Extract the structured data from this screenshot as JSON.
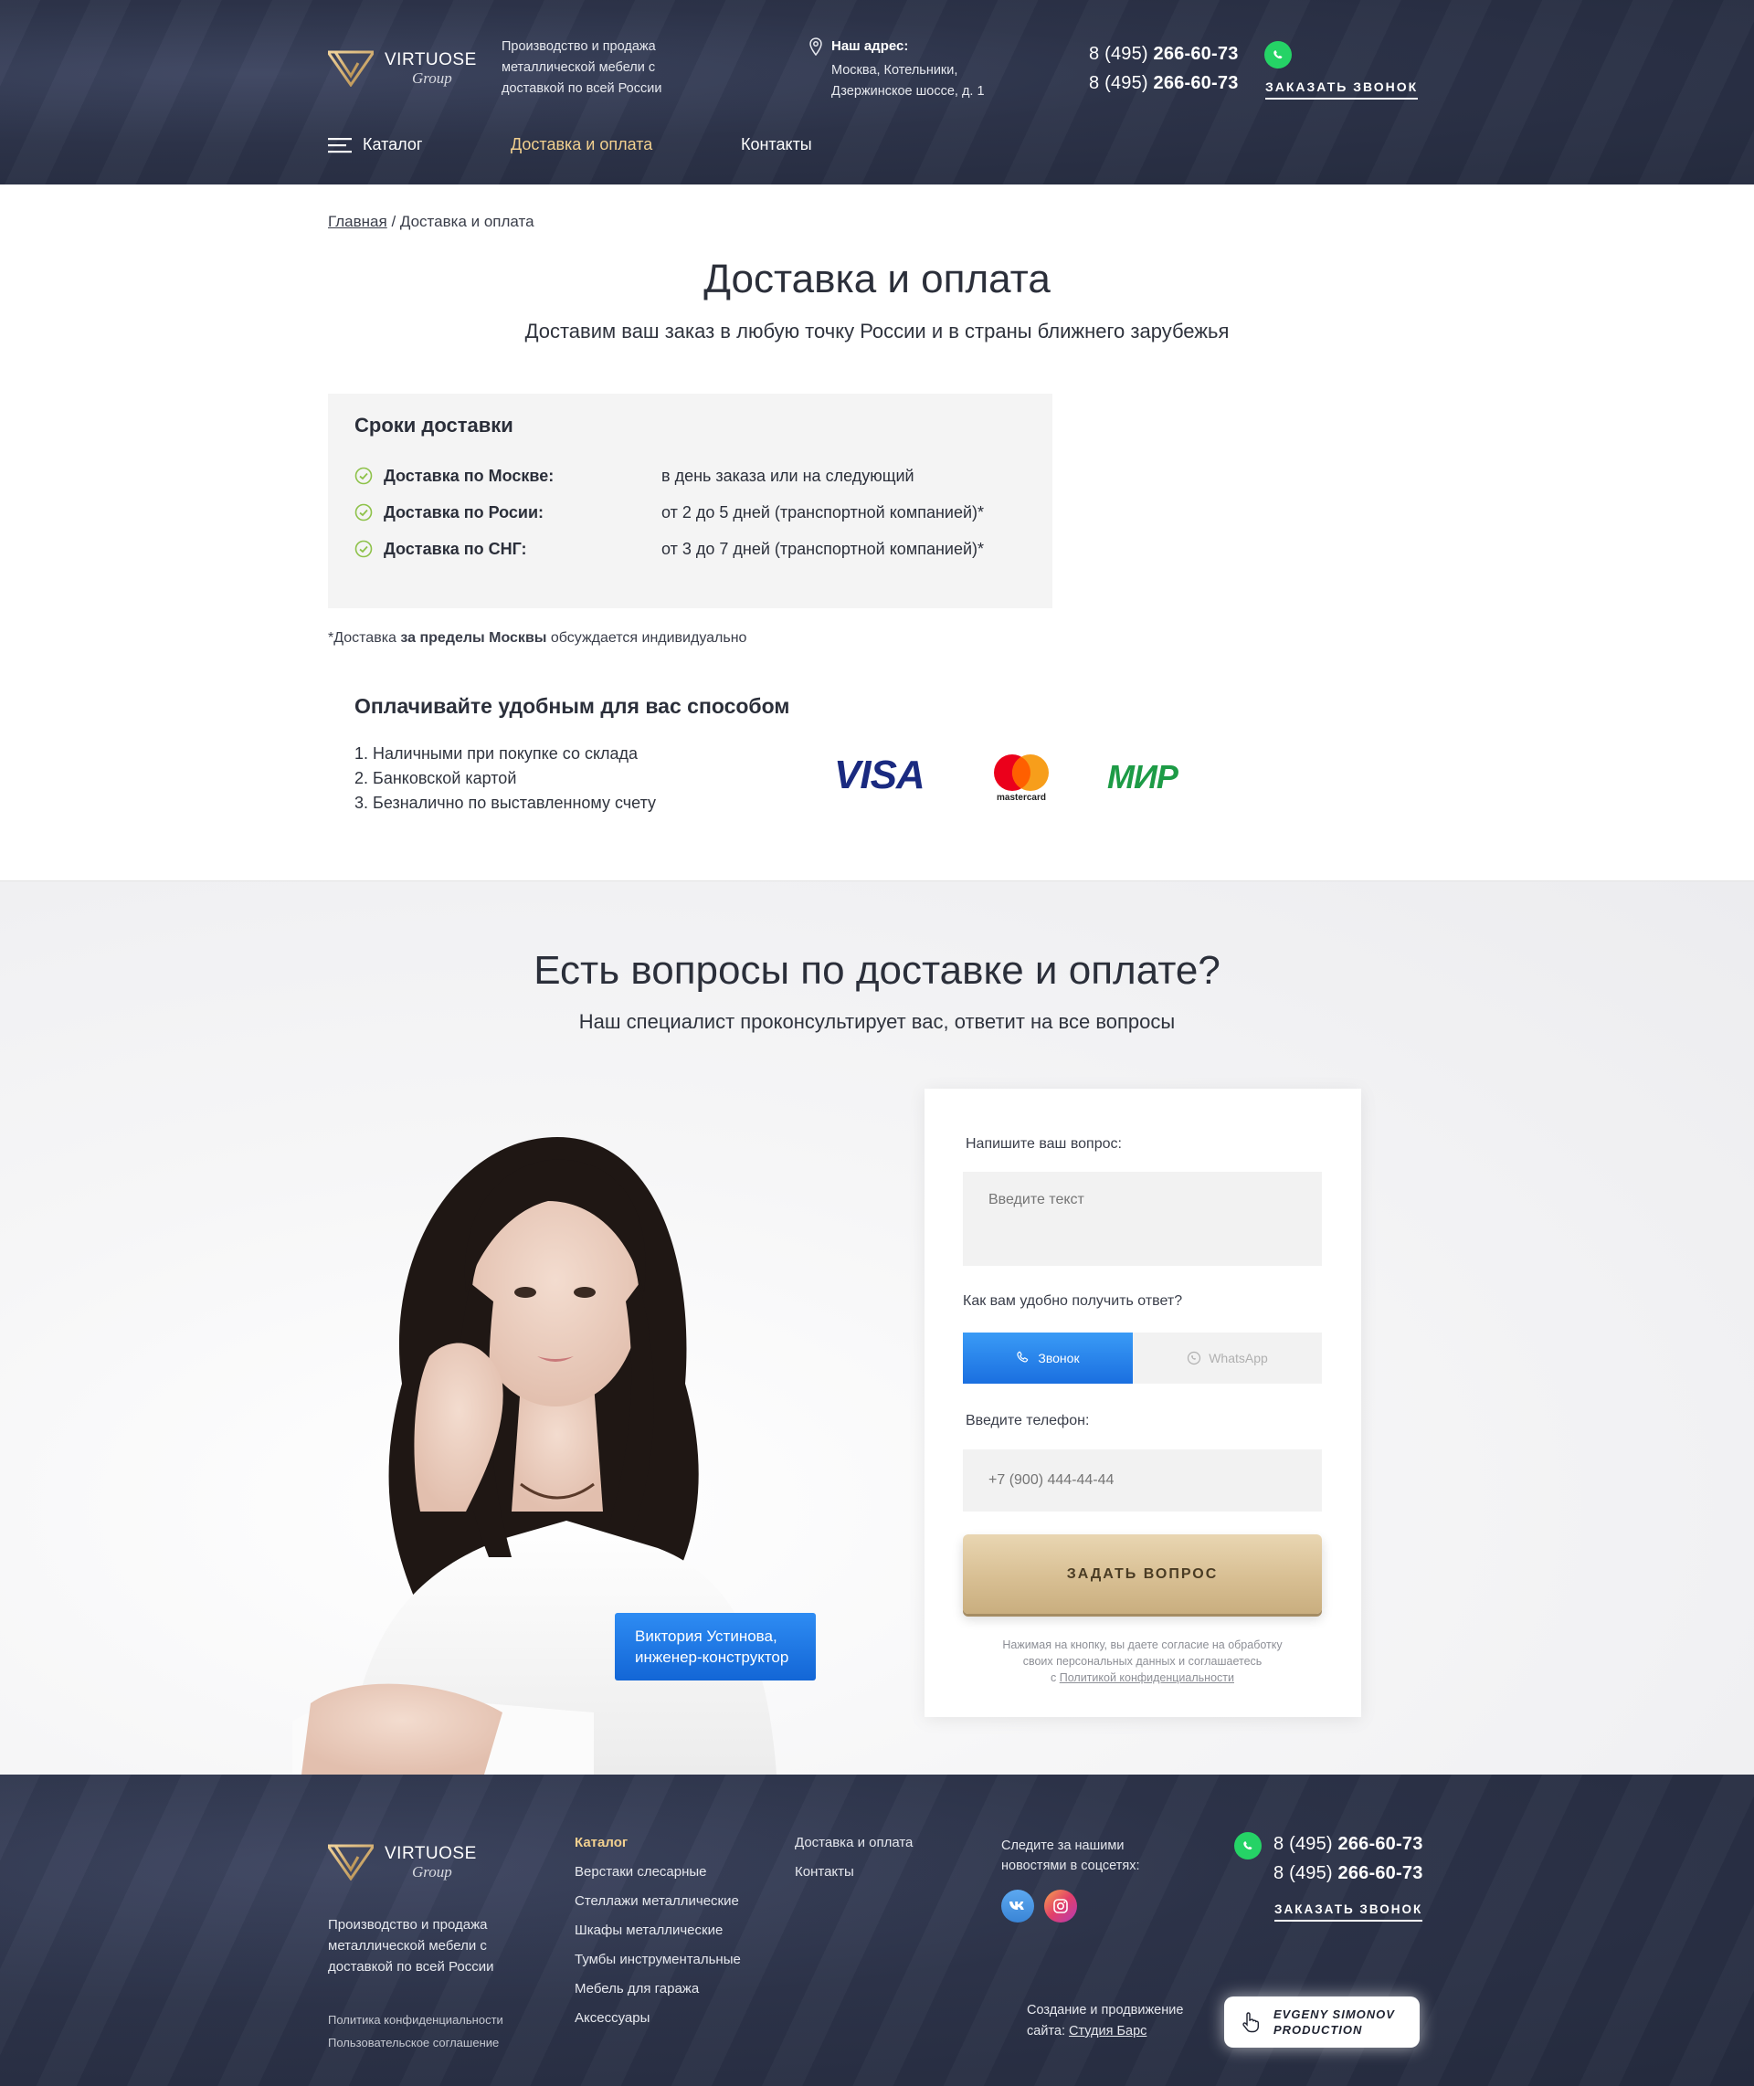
{
  "header": {
    "logo_name": "VIRTUOSE",
    "logo_sub": "Group",
    "tagline_lines": [
      "Производство и продажа",
      "металлической мебели с",
      "доставкой по всей России"
    ],
    "address_title": "Наш адрес:",
    "address_lines": [
      "Москва, Котельники,",
      "Дзержинское шоссе, д. 1"
    ],
    "phone_prefix": "8 (495) ",
    "phone_main": "266-60-73",
    "callback": "ЗАКАЗАТЬ ЗВОНОК",
    "nav": [
      {
        "label": "Каталог"
      },
      {
        "label": "Доставка и оплата"
      },
      {
        "label": "Контакты"
      }
    ]
  },
  "breadcrumb": {
    "home": "Главная",
    "sep": " / ",
    "current": "Доставка и оплата"
  },
  "page": {
    "title": "Доставка и оплата",
    "subtitle": "Доставим ваш заказ в любую точку России и в страны ближнего зарубежья"
  },
  "delivery": {
    "title": "Сроки доставки",
    "rows": [
      {
        "label": "Доставка по Москве:",
        "value": "в день заказа или на следующий"
      },
      {
        "label": "Доставка по Росии:",
        "value": "от 2 до 5 дней (транспортной компанией)*"
      },
      {
        "label": "Доставка по СНГ:",
        "value": "от 3 до 7 дней (транспортной компанией)*"
      }
    ],
    "note_pre": "*Доставка ",
    "note_bold": "за пределы Москвы",
    "note_post": " обсуждается индивидуально"
  },
  "payment": {
    "title": "Оплачивайте удобным для вас способом",
    "methods": [
      "1. Наличными при покупке со склада",
      "2. Банковской картой",
      "3. Безналично по выставленному счету"
    ],
    "logos": {
      "visa": "VISA",
      "mastercard": "mastercard",
      "mir": "МИР"
    }
  },
  "questions": {
    "title": "Есть вопросы по доставке и оплате?",
    "subtitle": "Наш специалист проконсультирует вас, ответит на все вопросы",
    "specialist_name": "Виктория Устинова,",
    "specialist_role": "инженер-конструктор"
  },
  "form": {
    "question_label": "Напишите ваш вопрос:",
    "question_placeholder": "Введите текст",
    "answer_label": "Как вам удобно получить ответ?",
    "option_call": "Звонок",
    "option_whatsapp": "WhatsApp",
    "phone_label": "Введите телефон:",
    "phone_placeholder": "+7 (900) 444-44-44",
    "submit": "ЗАДАТЬ ВОПРОС",
    "consent_lines": [
      "Нажимая на кнопку, вы даете согласие на обработку",
      "своих персональных данных и соглашаетесь"
    ],
    "consent_prefix": "с ",
    "consent_link": "Политикой конфиденциальности"
  },
  "footer": {
    "logo_name": "VIRTUOSE",
    "logo_sub": "Group",
    "tagline_lines": [
      "Производство и продажа",
      "металлической мебели с",
      "доставкой по всей России"
    ],
    "privacy": "Политика конфиденциальности",
    "agreement": "Пользовательское соглашение",
    "catalog_title": "Каталог",
    "catalog_items": [
      "Верстаки слесарные",
      "Стеллажи металлические",
      "Шкафы металлические",
      "Тумбы инструментальные",
      "Мебель для гаража",
      "Аксессуары"
    ],
    "links": [
      "Доставка и оплата",
      "Контакты"
    ],
    "social_text_lines": [
      "Следите за нашими",
      "новостями в соцсетях:"
    ],
    "phone_prefix": "8 (495) ",
    "phone_main": "266-60-73",
    "callback": "ЗАКАЗАТЬ ЗВОНОК",
    "creation_line1": "Создание и продвижение",
    "creation_prefix": "сайта: ",
    "creation_link": "Студия  Барс",
    "dev_line1": "EVGENY SIMONOV",
    "dev_line2": "PRODUCTION"
  },
  "colors": {
    "header_bg": "#2d344a",
    "accent_gold": "#f2d08f",
    "accent_blue": "#1a6fe0",
    "whatsapp": "#25d366"
  }
}
